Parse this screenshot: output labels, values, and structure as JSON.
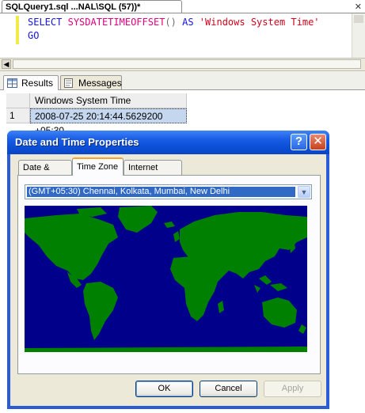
{
  "editor": {
    "tab_title": "SQLQuery1.sql ...NAL\\SQL (57))*",
    "line1": {
      "kw1": "SELECT",
      "fn": "SYSDATETIMEOFFSET",
      "paren": "()",
      "kw2": "AS",
      "str": "'Windows System Time'"
    },
    "line2": "GO"
  },
  "results": {
    "tabs": [
      {
        "label": "Results",
        "icon": "grid-icon",
        "active": true
      },
      {
        "label": "Messages",
        "icon": "messages-icon",
        "active": false
      }
    ],
    "columns": [
      "Windows System Time"
    ],
    "rows": [
      {
        "num": "1",
        "value": "2008-07-25 20:14:44.5629200 +05:30"
      }
    ]
  },
  "dialog": {
    "title": "Date and Time Properties",
    "help_glyph": "?",
    "close_glyph": "✕",
    "tabs": [
      "Date & Time",
      "Time Zone",
      "Internet Time"
    ],
    "active_tab": "Time Zone",
    "timezone_value": "(GMT+05:30) Chennai, Kolkata, Mumbai, New Delhi",
    "buttons": {
      "ok": "OK",
      "cancel": "Cancel",
      "apply": "Apply"
    },
    "colors": {
      "ocean": "#00008a",
      "land": "#008000",
      "title_bar": "#0a4fd6"
    }
  }
}
